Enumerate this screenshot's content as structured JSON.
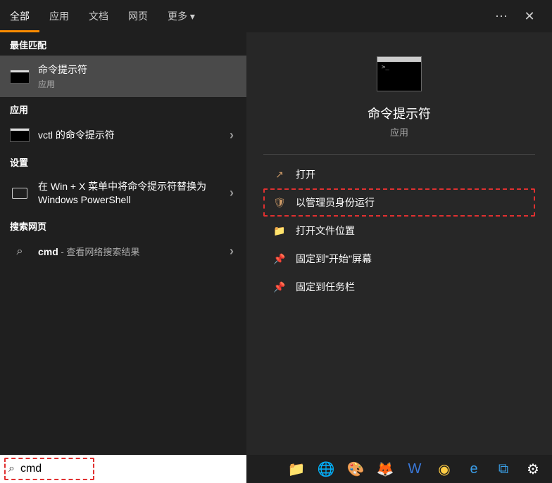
{
  "header": {
    "tabs": [
      "全部",
      "应用",
      "文档",
      "网页",
      "更多"
    ],
    "active_tab": 0
  },
  "sections": {
    "best_match": "最佳匹配",
    "apps": "应用",
    "settings": "设置",
    "web": "搜索网页"
  },
  "results": {
    "best": {
      "title": "命令提示符",
      "sub": "应用"
    },
    "app1": {
      "title": "vctl 的命令提示符"
    },
    "setting1": {
      "title": "在 Win + X 菜单中将命令提示符替换为 Windows PowerShell"
    },
    "web1": {
      "prefix": "cmd",
      "suffix": " - 查看网络搜索结果"
    }
  },
  "detail": {
    "title": "命令提示符",
    "sub": "应用",
    "actions": [
      {
        "icon": "↗",
        "label": "打开"
      },
      {
        "icon": "🛡",
        "label": "以管理员身份运行",
        "highlighted": true
      },
      {
        "icon": "📁",
        "label": "打开文件位置"
      },
      {
        "icon": "📌",
        "label": "固定到\"开始\"屏幕"
      },
      {
        "icon": "📌",
        "label": "固定到任务栏"
      }
    ]
  },
  "search": {
    "value": "cmd"
  },
  "taskbar": {
    "icons": [
      {
        "name": "file-explorer-icon",
        "glyph": "📁",
        "color": "#ffcc44"
      },
      {
        "name": "edge-icon",
        "glyph": "🌐",
        "color": "#3aa0e8"
      },
      {
        "name": "paint-icon",
        "glyph": "🎨",
        "color": "#e05050"
      },
      {
        "name": "firefox-icon",
        "glyph": "🦊",
        "color": "#ff9500"
      },
      {
        "name": "wps-icon",
        "glyph": "W",
        "color": "#3a78d8"
      },
      {
        "name": "chrome-icon",
        "glyph": "◉",
        "color": "#ffcc44"
      },
      {
        "name": "ie-icon",
        "glyph": "e",
        "color": "#3a9de8"
      },
      {
        "name": "vscode-icon",
        "glyph": "⧉",
        "color": "#3aa0e8"
      },
      {
        "name": "settings-icon",
        "glyph": "⚙",
        "color": "#ffffff"
      }
    ]
  }
}
